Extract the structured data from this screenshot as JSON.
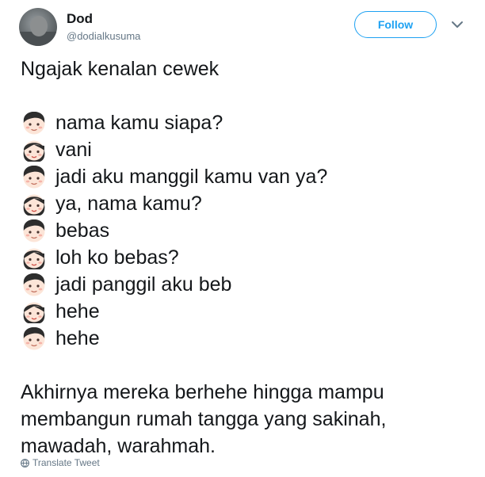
{
  "author": {
    "name": "Dod",
    "handle": "@dodialkusuma"
  },
  "follow_label": "Follow",
  "tweet": {
    "intro": "Ngajak kenalan cewek",
    "dialogue": [
      {
        "speaker": "boy-emoji",
        "text": "nama kamu siapa?"
      },
      {
        "speaker": "girl-emoji",
        "text": "vani"
      },
      {
        "speaker": "boy-emoji",
        "text": "jadi aku manggil kamu van ya?"
      },
      {
        "speaker": "girl-emoji",
        "text": "ya, nama kamu?"
      },
      {
        "speaker": "boy-emoji",
        "text": "bebas"
      },
      {
        "speaker": "girl-emoji",
        "text": "loh ko bebas?"
      },
      {
        "speaker": "boy-emoji",
        "text": "jadi panggil aku beb"
      },
      {
        "speaker": "girl-emoji",
        "text": "hehe"
      },
      {
        "speaker": "boy-emoji",
        "text": "hehe"
      }
    ],
    "outro": [
      "Akhirnya mereka berhehe hingga mampu",
      "membangun rumah tangga yang sakinah,",
      "mawadah, warahmah."
    ]
  },
  "translate_label": "Translate Tweet",
  "colors": {
    "accent": "#1da1f2",
    "text": "#14171a",
    "muted": "#657786"
  }
}
